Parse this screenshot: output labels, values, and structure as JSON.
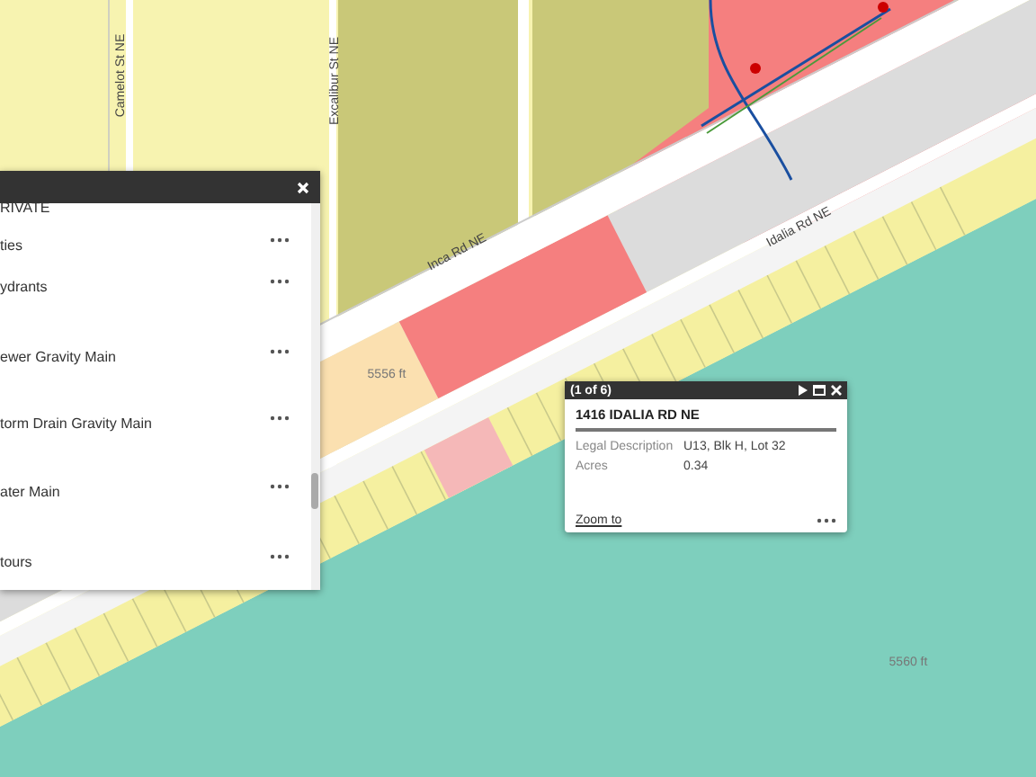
{
  "map": {
    "labels": [
      {
        "text": "Camelot St NE",
        "kind": "vertical"
      },
      {
        "text": "Excalibur St NE",
        "kind": "vertical"
      },
      {
        "text": "Inca Rd NE",
        "kind": "road"
      },
      {
        "text": "Idalia Rd NE",
        "kind": "road"
      },
      {
        "text": "5556 ft",
        "kind": "contour"
      },
      {
        "text": "5560 ft",
        "kind": "contour"
      }
    ]
  },
  "layers_panel": {
    "items": [
      {
        "label": "RIVATE",
        "kind": "group"
      },
      {
        "label": "ties",
        "kind": "layer"
      },
      {
        "label": "ydrants",
        "kind": "layer"
      },
      {
        "label": "ewer Gravity Main",
        "kind": "layer"
      },
      {
        "label": "torm Drain Gravity Main",
        "kind": "layer"
      },
      {
        "label": "ater Main",
        "kind": "layer"
      },
      {
        "label": "tours",
        "kind": "layer"
      }
    ]
  },
  "popup": {
    "counter": "(1 of 6)",
    "title": "1416 IDALIA RD NE",
    "fields": [
      {
        "label": "Legal Description",
        "value": "U13, Blk H, Lot 32"
      },
      {
        "label": "Acres",
        "value": "0.34"
      }
    ],
    "link": "Zoom to"
  }
}
